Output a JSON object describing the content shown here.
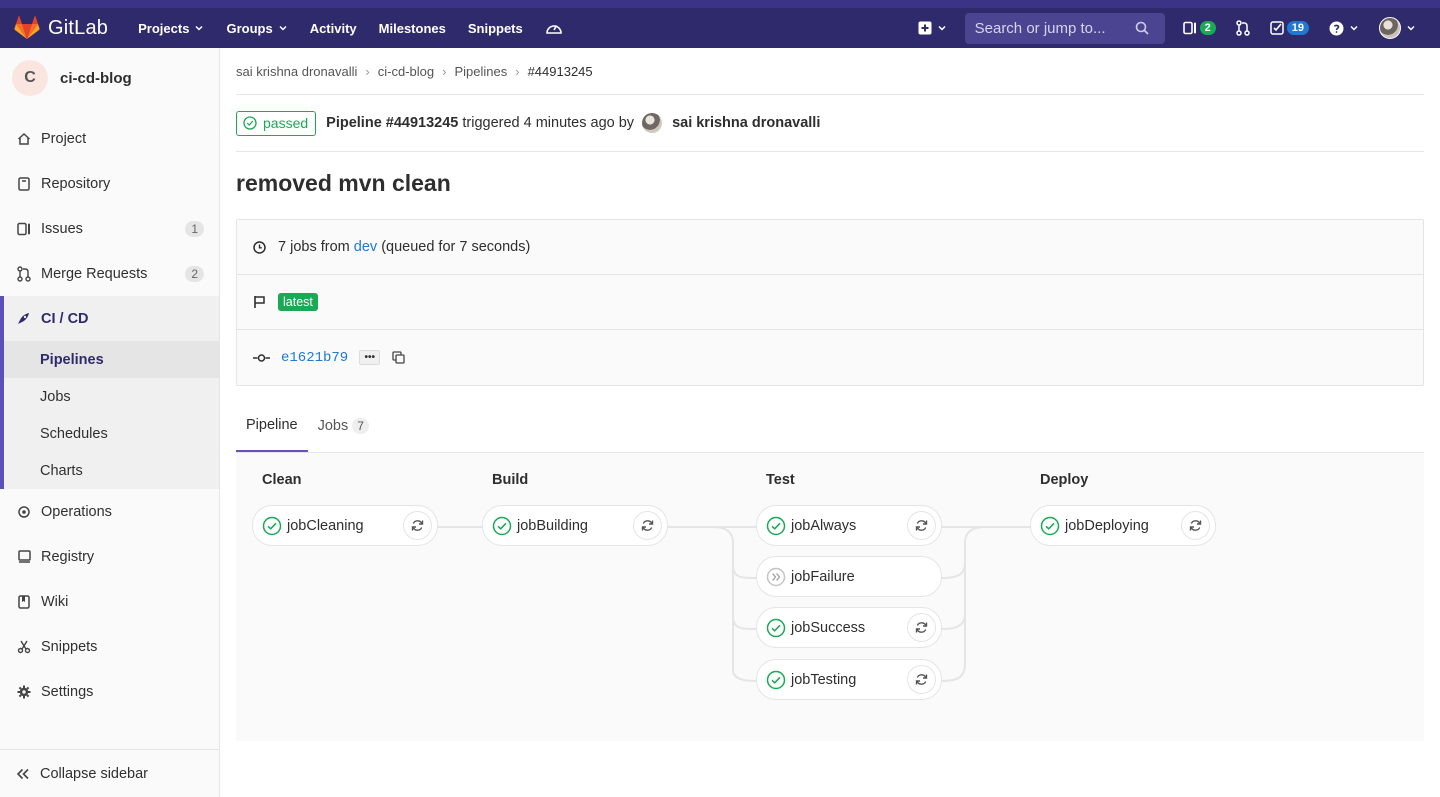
{
  "nav": {
    "brand": "GitLab",
    "links": [
      "Projects",
      "Groups",
      "Activity",
      "Milestones",
      "Snippets"
    ],
    "search_placeholder": "Search or jump to...",
    "issues_count": "2",
    "todos_count": "19",
    "colors": {
      "bar": "#2f2a6b",
      "search": "#4b4591",
      "badge_green": "#1aaa55",
      "badge_blue": "#1f78d1"
    }
  },
  "sidebar": {
    "project_initial": "C",
    "project_name": "ci-cd-blog",
    "items_top": [
      {
        "label": "Project",
        "icon": "home-icon"
      },
      {
        "label": "Repository",
        "icon": "book-icon"
      },
      {
        "label": "Issues",
        "icon": "issues-icon",
        "count": "1"
      },
      {
        "label": "Merge Requests",
        "icon": "merge-request-icon",
        "count": "2"
      }
    ],
    "cicd": {
      "label": "CI / CD",
      "sub": [
        "Pipelines",
        "Jobs",
        "Schedules",
        "Charts"
      ]
    },
    "items_bottom": [
      {
        "label": "Operations",
        "icon": "cloud-gear-icon"
      },
      {
        "label": "Registry",
        "icon": "disk-icon"
      },
      {
        "label": "Wiki",
        "icon": "book-open-icon"
      },
      {
        "label": "Snippets",
        "icon": "scissors-icon"
      },
      {
        "label": "Settings",
        "icon": "gear-icon"
      }
    ],
    "collapse": "Collapse sidebar"
  },
  "breadcrumb": [
    "sai krishna dronavalli",
    "ci-cd-blog",
    "Pipelines",
    "#44913245"
  ],
  "header": {
    "status": "passed",
    "pipeline": "Pipeline #44913245",
    "triggered": "triggered 4 minutes ago by",
    "user": "sai krishna dronavalli"
  },
  "commit_title": "removed mvn clean",
  "info": {
    "jobs_prefix": "7 jobs from",
    "branch": "dev",
    "queued": "(queued for 7 seconds)",
    "tag": "latest",
    "sha": "e1621b79",
    "ellipsis": "•••"
  },
  "tabs": {
    "pipeline": "Pipeline",
    "jobs": "Jobs",
    "jobs_count": "7"
  },
  "stages": [
    {
      "name": "Clean",
      "jobs": [
        {
          "name": "jobCleaning",
          "status": "passed",
          "action": "retry"
        }
      ]
    },
    {
      "name": "Build",
      "jobs": [
        {
          "name": "jobBuilding",
          "status": "passed",
          "action": "retry"
        }
      ]
    },
    {
      "name": "Test",
      "jobs": [
        {
          "name": "jobAlways",
          "status": "passed",
          "action": "retry"
        },
        {
          "name": "jobFailure",
          "status": "skipped",
          "action": ""
        },
        {
          "name": "jobSuccess",
          "status": "passed",
          "action": "retry"
        },
        {
          "name": "jobTesting",
          "status": "passed",
          "action": "retry"
        }
      ]
    },
    {
      "name": "Deploy",
      "jobs": [
        {
          "name": "jobDeploying",
          "status": "passed",
          "action": "retry"
        }
      ]
    }
  ]
}
